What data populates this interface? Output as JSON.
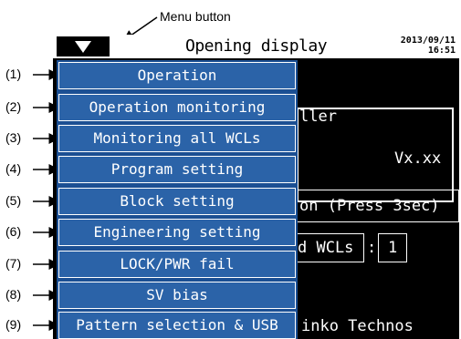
{
  "annotation": {
    "menu_button_label": "Menu button",
    "markers": [
      "(1)",
      "(2)",
      "(3)",
      "(4)",
      "(5)",
      "(6)",
      "(7)",
      "(8)",
      "(9)"
    ]
  },
  "screen": {
    "title": "Opening display",
    "date": "2013/09/11",
    "time": "16:51",
    "background": {
      "controller_partial": "ller",
      "version": "Vx.xx",
      "press_partial": "on (Press 3sec)",
      "wcls_partial": "d WCLs",
      "colon": ":",
      "count": "1",
      "company_partial": "inko Technos"
    },
    "menu_items": [
      "Operation",
      "Operation monitoring",
      "Monitoring all WCLs",
      "Program setting",
      "Block setting",
      "Engineering setting",
      "LOCK/PWR fail",
      "SV bias",
      "Pattern selection & USB"
    ]
  },
  "colors": {
    "screen_bg": "#000000",
    "menu_bg": "#1b4f93",
    "menu_item_bg": "#2b63a8",
    "menu_item_border": "#ffffff",
    "title_bar_bg": "#ffffff"
  },
  "icons": {
    "menu_button": "down-triangle-icon",
    "annotation_arrows": "right-arrow-icon"
  }
}
